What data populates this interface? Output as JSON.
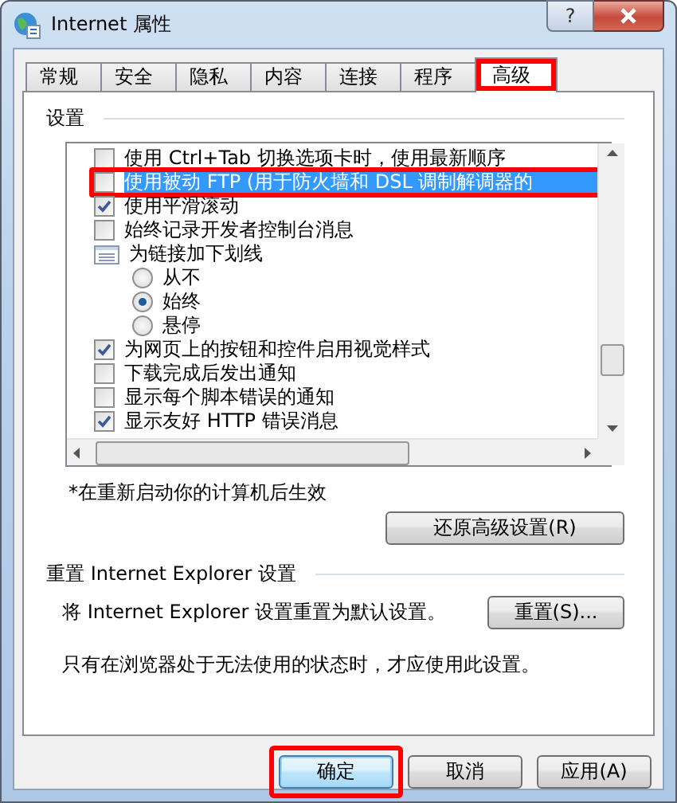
{
  "window": {
    "title": "Internet 属性",
    "help": "?"
  },
  "tabs": [
    {
      "label": "常规",
      "selected": false,
      "annotated": false
    },
    {
      "label": "安全",
      "selected": false,
      "annotated": false
    },
    {
      "label": "隐私",
      "selected": false,
      "annotated": false
    },
    {
      "label": "内容",
      "selected": false,
      "annotated": false
    },
    {
      "label": "连接",
      "selected": false,
      "annotated": false
    },
    {
      "label": "程序",
      "selected": false,
      "annotated": false
    },
    {
      "label": "高级",
      "selected": true,
      "annotated": true
    }
  ],
  "settings": {
    "title": "设置",
    "items": [
      {
        "kind": "checkbox",
        "label": "使用 Ctrl+Tab 切换选项卡时，使用最新顺序",
        "checked": false,
        "selected": false,
        "annotated": false
      },
      {
        "kind": "checkbox",
        "label": "使用被动 FTP (用于防火墙和 DSL 调制解调器的",
        "checked": false,
        "selected": true,
        "annotated": true
      },
      {
        "kind": "checkbox",
        "label": "使用平滑滚动",
        "checked": true,
        "selected": false,
        "annotated": false
      },
      {
        "kind": "checkbox",
        "label": "始终记录开发者控制台消息",
        "checked": false,
        "selected": false,
        "annotated": false
      },
      {
        "kind": "group",
        "label": "为链接加下划线",
        "selected": false,
        "annotated": false,
        "children": [
          {
            "kind": "radio",
            "label": "从不",
            "checked": false
          },
          {
            "kind": "radio",
            "label": "始终",
            "checked": true
          },
          {
            "kind": "radio",
            "label": "悬停",
            "checked": false
          }
        ]
      },
      {
        "kind": "checkbox",
        "label": "为网页上的按钮和控件启用视觉样式",
        "checked": true,
        "selected": false,
        "annotated": false
      },
      {
        "kind": "checkbox",
        "label": "下载完成后发出通知",
        "checked": false,
        "selected": false,
        "annotated": false
      },
      {
        "kind": "checkbox",
        "label": "显示每个脚本错误的通知",
        "checked": false,
        "selected": false,
        "annotated": false
      },
      {
        "kind": "checkbox",
        "label": "显示友好 HTTP 错误消息",
        "checked": true,
        "selected": false,
        "annotated": false
      }
    ],
    "note": "*在重新启动你的计算机后生效",
    "restore_button": "还原高级设置(R)"
  },
  "reset": {
    "title": "重置 Internet Explorer 设置",
    "description": "将 Internet Explorer 设置重置为默认设置。",
    "button": "重置(S)...",
    "warning": "只有在浏览器处于无法使用的状态时，才应使用此设置。"
  },
  "buttons": [
    {
      "label": "确定",
      "default": true,
      "annotated": true
    },
    {
      "label": "取消",
      "default": false,
      "annotated": false
    },
    {
      "label": "应用(A)",
      "default": false,
      "annotated": false
    }
  ]
}
